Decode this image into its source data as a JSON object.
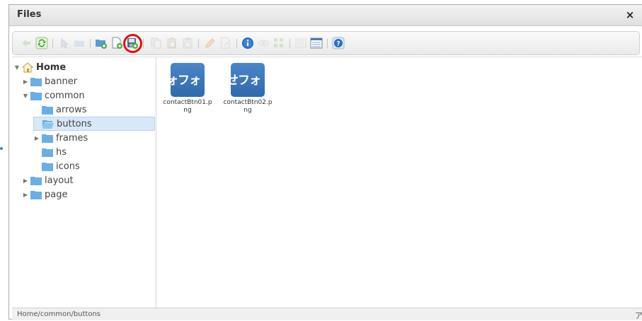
{
  "window": {
    "title": "Files",
    "close_label": "×"
  },
  "toolbar": {
    "buttons": [
      {
        "icon": "back-icon",
        "enabled": false
      },
      {
        "icon": "reload-icon",
        "enabled": true
      },
      {
        "icon": "select-icon",
        "enabled": false
      },
      {
        "icon": "open-icon",
        "enabled": false
      },
      {
        "icon": "new-folder-icon",
        "enabled": true
      },
      {
        "icon": "new-file-icon",
        "enabled": true
      },
      {
        "icon": "upload-icon",
        "enabled": true
      },
      {
        "icon": "copy-icon",
        "enabled": false
      },
      {
        "icon": "cut-icon",
        "enabled": false
      },
      {
        "icon": "paste-icon",
        "enabled": false
      },
      {
        "icon": "rename-icon",
        "enabled": false
      },
      {
        "icon": "edit-file-icon",
        "enabled": false
      },
      {
        "icon": "info-icon",
        "enabled": true
      },
      {
        "icon": "preview-icon",
        "enabled": false
      },
      {
        "icon": "icons-view-icon",
        "enabled": false
      },
      {
        "icon": "list-view-icon",
        "enabled": false
      },
      {
        "icon": "details-view-icon",
        "enabled": true
      },
      {
        "icon": "help-icon",
        "enabled": true
      }
    ],
    "highlight_color": "#e11111"
  },
  "tree": {
    "home": "Home",
    "items": [
      {
        "label": "banner",
        "level": 1,
        "expanded": false
      },
      {
        "label": "common",
        "level": 1,
        "expanded": true
      },
      {
        "label": "arrows",
        "level": 2
      },
      {
        "label": "buttons",
        "level": 2,
        "selected": true
      },
      {
        "label": "frames",
        "level": 2,
        "expanded": false
      },
      {
        "label": "hs",
        "level": 2
      },
      {
        "label": "icons",
        "level": 2
      },
      {
        "label": "layout",
        "level": 1,
        "expanded": false
      },
      {
        "label": "page",
        "level": 1,
        "expanded": false
      }
    ]
  },
  "files": [
    {
      "name": "contactBtn01.png",
      "name_line1": "contactBtn01.p",
      "name_line2": "ng",
      "thumb_text": "ォフォ"
    },
    {
      "name": "contactBtn02.png",
      "name_line1": "contactBtn02.p",
      "name_line2": "ng",
      "thumb_text": "せフォ"
    }
  ],
  "status": {
    "path": "Home/common/buttons",
    "right_text": "ア"
  },
  "colors": {
    "accent": "#3b82c4",
    "folder": "#6aaee6",
    "selected_bg": "#d7e8f8"
  }
}
